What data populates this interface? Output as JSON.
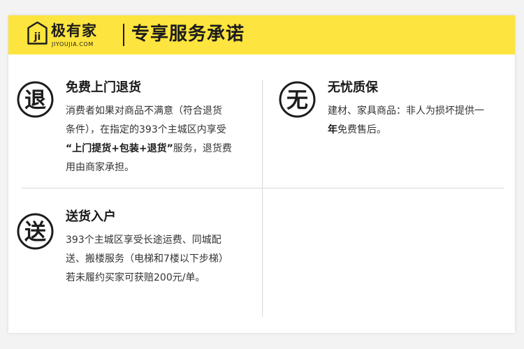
{
  "brand": {
    "name_cn": "极有家",
    "domain": "JIYOUJIA.COM",
    "logo_letter": "ji",
    "accent_color": "#fde43e"
  },
  "header": {
    "title": "专享服务承诺"
  },
  "services": [
    {
      "badge": "退",
      "title": "免费上门退货",
      "lines": [
        [
          "消费者如果对商品不满意（符合退货"
        ],
        [
          "条件），在指定的393个主城区内享受"
        ],
        [
          {
            "bold": "“上门提货+包装+退货”"
          },
          "服务，退货费"
        ],
        [
          "用由商家承担。"
        ]
      ]
    },
    {
      "badge": "无",
      "title": "无忧质保",
      "lines": [
        [
          "建材、家具商品：非人为损坏提供一"
        ],
        [
          {
            "bold": "年"
          },
          "免费售后。"
        ]
      ]
    },
    {
      "badge": "送",
      "title": "送货入户",
      "lines": [
        [
          "393个主城区享受长途运费、同城配"
        ],
        [
          "送、搬楼服务（电梯和7楼以下步梯）"
        ],
        [
          "若未履约买家可获赔200元/单。"
        ]
      ]
    }
  ]
}
